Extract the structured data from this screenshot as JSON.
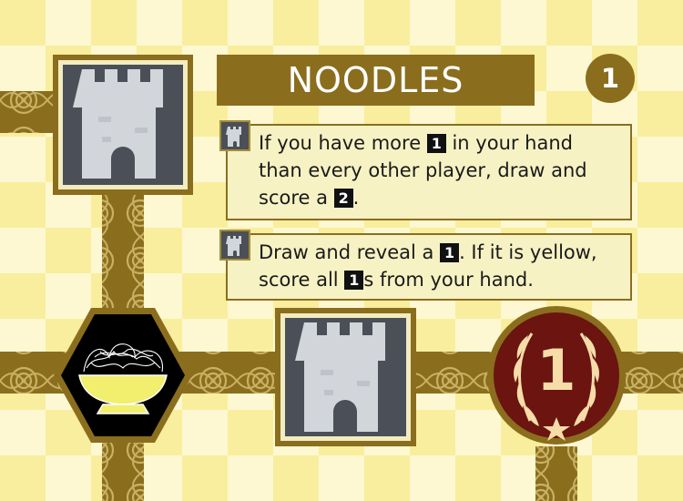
{
  "card": {
    "title": "NOODLES",
    "age": "1",
    "dogma_effects": [
      {
        "icon": "castle-icon",
        "parts": [
          "If you have more ",
          "1",
          " in your hand than every other player, draw and score a ",
          "2",
          "."
        ],
        "lines": [
          [
            "If you have more ",
            {
              "badge": "1"
            },
            " in your hand"
          ],
          [
            "than every other player, draw and"
          ],
          [
            "score a ",
            {
              "badge": "2"
            },
            "."
          ]
        ]
      },
      {
        "icon": "castle-icon",
        "lines": [
          [
            "Draw and reveal a ",
            {
              "badge": "1"
            },
            ". If it is yellow,"
          ],
          [
            "score all ",
            {
              "badge": "1"
            },
            "s from your hand."
          ]
        ]
      }
    ],
    "icon_slots": [
      {
        "slot": "top-left",
        "icon": "castle-icon"
      },
      {
        "slot": "bottom-left",
        "icon": "noodle-bowl-icon"
      },
      {
        "slot": "bottom-middle",
        "icon": "castle-icon"
      },
      {
        "slot": "bottom-right",
        "icon": "laurel-wreath-icon",
        "value": "1"
      }
    ]
  },
  "colors": {
    "card_yellow": "#fbf3a6",
    "checker_light": "#fdf8d2",
    "checker_dark": "#f7ec98",
    "band_gold": "#8a6e1e",
    "ornament": "#c9b063",
    "icon_slate": "#4b4f57",
    "castle_grey": "#d2d5da",
    "bowl_yellow": "#f2ee6e",
    "wreath_red": "#6b1410",
    "wreath_cream": "#f5dca8"
  }
}
